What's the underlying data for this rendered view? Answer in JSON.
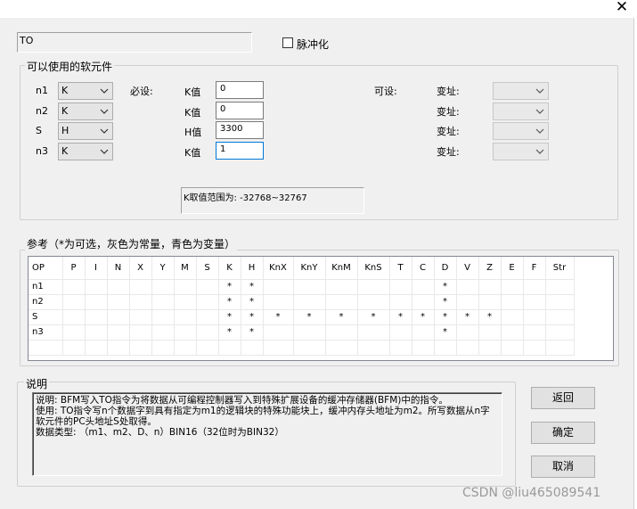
{
  "window": {
    "close_glyph": "✕"
  },
  "instruction": {
    "value": "TO"
  },
  "pulse": {
    "label": "脉冲化",
    "checked": false
  },
  "available_group": {
    "title": "可以使用的软元件"
  },
  "params": [
    {
      "name": "n1",
      "type": "K",
      "value_label": "K值",
      "value": "0"
    },
    {
      "name": "n2",
      "type": "K",
      "value_label": "K值",
      "value": "0"
    },
    {
      "name": "S",
      "type": "H",
      "value_label": "H值",
      "value": "3300"
    },
    {
      "name": "n3",
      "type": "K",
      "value_label": "K值",
      "value": "1"
    }
  ],
  "required_label": "必设:",
  "optional_label": "可设:",
  "offset_labels": [
    "变址:",
    "变址:",
    "变址:",
    "变址:"
  ],
  "range_text": "K取值范围为: -32768~32767",
  "reference_group": {
    "title": "参考（*为可选，灰色为常量，青色为变量）"
  },
  "table": {
    "columns": [
      "OP",
      "P",
      "I",
      "N",
      "X",
      "Y",
      "M",
      "S",
      "K",
      "H",
      "KnX",
      "KnY",
      "KnM",
      "KnS",
      "T",
      "C",
      "D",
      "V",
      "Z",
      "E",
      "F",
      "Str"
    ],
    "rows": [
      [
        "n1",
        "",
        "",
        "",
        "",
        "",
        "",
        "",
        "*",
        "*",
        "",
        "",
        "",
        "",
        "",
        "",
        "*",
        "",
        "",
        "",
        "",
        ""
      ],
      [
        "n2",
        "",
        "",
        "",
        "",
        "",
        "",
        "",
        "*",
        "*",
        "",
        "",
        "",
        "",
        "",
        "",
        "*",
        "",
        "",
        "",
        "",
        ""
      ],
      [
        "S",
        "",
        "",
        "",
        "",
        "",
        "",
        "",
        "*",
        "*",
        "*",
        "*",
        "*",
        "*",
        "*",
        "*",
        "*",
        "*",
        "*",
        "",
        "",
        ""
      ],
      [
        "n3",
        "",
        "",
        "",
        "",
        "",
        "",
        "",
        "*",
        "*",
        "",
        "",
        "",
        "",
        "",
        "",
        "*",
        "",
        "",
        "",
        "",
        ""
      ],
      [
        "",
        "",
        "",
        "",
        "",
        "",
        "",
        "",
        "",
        "",
        "",
        "",
        "",
        "",
        "",
        "",
        "",
        "",
        "",
        "",
        "",
        ""
      ]
    ]
  },
  "description_group": {
    "title": "说明"
  },
  "description": [
    "说明: BFM写入TO指令为将数据从可编程控制器写入到特殊扩展设备的缓冲存储器(BFM)中的指令。",
    "使用: TO指令写n个数据字到具有指定为m1的逻辑块的特殊功能块上，缓冲内存头地址为m2。所写数据从n字软元件的PC头地址S处取得。",
    "数据类型: （m1、m2、D、n）BIN16（32位时为BIN32）"
  ],
  "buttons": {
    "back": "返回",
    "ok": "确定",
    "cancel": "取消"
  },
  "watermark": "CSDN @liu465089541"
}
